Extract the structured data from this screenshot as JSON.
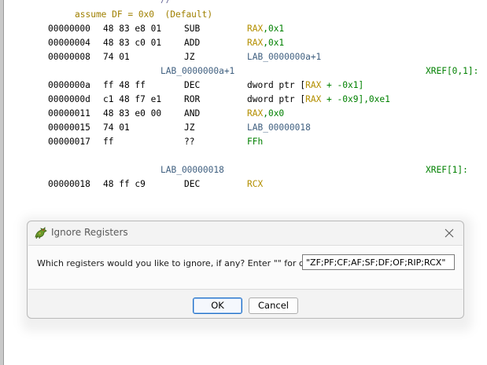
{
  "listing": {
    "top_comment": "//",
    "assume": "assume DF = 0x0  (Default)",
    "lines": [
      {
        "addr": "00000000",
        "bytes": "48 83 e8 01",
        "mn": "SUB",
        "op_reg": "RAX",
        "op_rest": ",0x1"
      },
      {
        "addr": "00000004",
        "bytes": "48 83 c0 01",
        "mn": "ADD",
        "op_reg": "RAX",
        "op_rest": ",0x1"
      },
      {
        "addr": "00000008",
        "bytes": "74 01",
        "mn": "JZ",
        "op_label": "LAB_0000000a+1"
      }
    ],
    "label1": {
      "name": "LAB_0000000a+1",
      "xref": "XREF[0,1]:"
    },
    "lines2": [
      {
        "addr": "0000000a",
        "bytes": "ff 48 ff",
        "mn": "DEC",
        "op_pre": "dword ptr [",
        "op_reg": "RAX",
        "op_post": " + -0x1]"
      },
      {
        "addr": "0000000d",
        "bytes": "c1 48 f7 e1",
        "mn": "ROR",
        "op_pre": "dword ptr [",
        "op_reg": "RAX",
        "op_post": " + -0x9],0xe1"
      },
      {
        "addr": "00000011",
        "bytes": "48 83 e0 00",
        "mn": "AND",
        "op_reg": "RAX",
        "op_rest": ",0x0"
      },
      {
        "addr": "00000015",
        "bytes": "74 01",
        "mn": "JZ",
        "op_label": "LAB_00000018"
      },
      {
        "addr": "00000017",
        "bytes": "ff",
        "mn": "??",
        "op_plain": "FFh"
      }
    ],
    "label2": {
      "name": "LAB_00000018",
      "xref": "XREF[1]:"
    },
    "lines3": [
      {
        "addr": "00000018",
        "bytes": "48 ff c9",
        "mn": "DEC",
        "op_reg": "RCX"
      }
    ]
  },
  "dialog": {
    "title": "Ignore Registers",
    "prompt": "Which registers would you like to ignore, if any? Enter \"\" for default.",
    "input_value": "\"ZF;PF;CF;AF;SF;DF;OF;RIP;RCX\"",
    "ok_label": "OK",
    "cancel_label": "Cancel"
  }
}
